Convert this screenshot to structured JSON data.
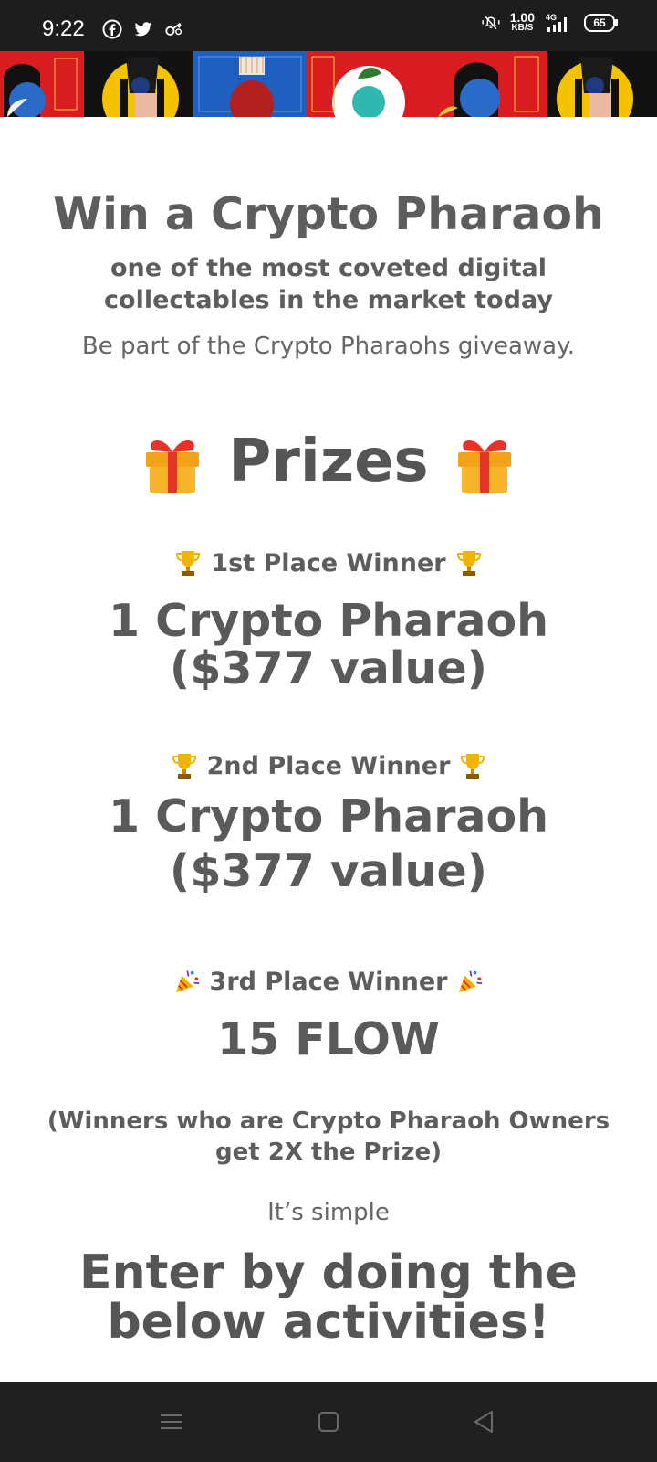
{
  "status_bar": {
    "time": "9:22",
    "net_speed_value": "1.00",
    "net_speed_unit": "KB/S",
    "network_type": "4G",
    "battery": "65",
    "left_icons": [
      "facebook-icon",
      "twitter-icon",
      "key-icon"
    ],
    "right_icons": [
      "mute-icon",
      "signal-icon",
      "battery-icon"
    ]
  },
  "banner": {
    "tiles": [
      "red",
      "black",
      "blue",
      "red",
      "red",
      "black"
    ]
  },
  "main": {
    "title": "Win a Crypto Pharaoh",
    "subtitle": "one of the most coveted digital collectables in the market today",
    "lead": "Be part of the Crypto Pharaohs giveaway.",
    "prizes_heading": "Prizes",
    "prizes": [
      {
        "label": "1st Place Winner",
        "value": "1 Crypto Pharaoh ($377 value)",
        "icon": "trophy-icon"
      },
      {
        "label": "2nd Place Winner",
        "value": "1 Crypto Pharaoh ($377 value)",
        "icon": "trophy-icon"
      },
      {
        "label": "3rd Place Winner",
        "value": "15 FLOW",
        "icon": "party-popper-icon"
      }
    ],
    "note": "(Winners who are Crypto Pharaoh Owners get 2X the Prize)",
    "simple": "It’s simple",
    "enter_heading": "Enter by doing the below activities!"
  },
  "nav_bar": {
    "buttons": [
      "menu-icon",
      "home-icon",
      "back-icon"
    ]
  },
  "colors": {
    "text": "#5d5d5d",
    "status_bg": "#1d1d1d",
    "nav_bg": "#202020",
    "tile_red": "#d91c20",
    "tile_blue": "#1f5fbf",
    "tile_black": "#121212"
  }
}
